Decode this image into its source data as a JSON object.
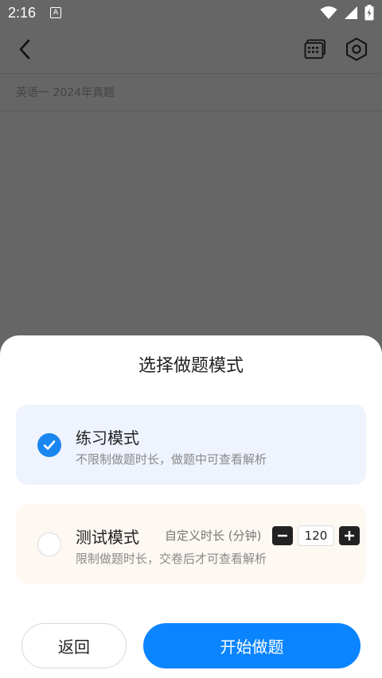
{
  "status_bar": {
    "time": "2:16",
    "badge": "A"
  },
  "header": {
    "back_icon": "chevron-left-icon",
    "calendar_icon": "calendar-icon",
    "settings_icon": "hexagon-settings-icon"
  },
  "subtitle": "英语一 2024年真题",
  "sheet": {
    "title": "选择做题模式",
    "practice": {
      "name": "练习模式",
      "desc": "不限制做题时长，做题中可查看解析",
      "checked": true
    },
    "test": {
      "name": "测试模式",
      "duration_label": "自定义时长 (分钟)",
      "duration_value": "120",
      "desc": "限制做题时长，交卷后才可查看解析",
      "checked": false
    },
    "back_label": "返回",
    "start_label": "开始做题"
  },
  "colors": {
    "overlay": "#666666",
    "accent": "#0a84ff",
    "practice_bg": "#eef3fd",
    "test_bg": "#fdf8f2"
  }
}
